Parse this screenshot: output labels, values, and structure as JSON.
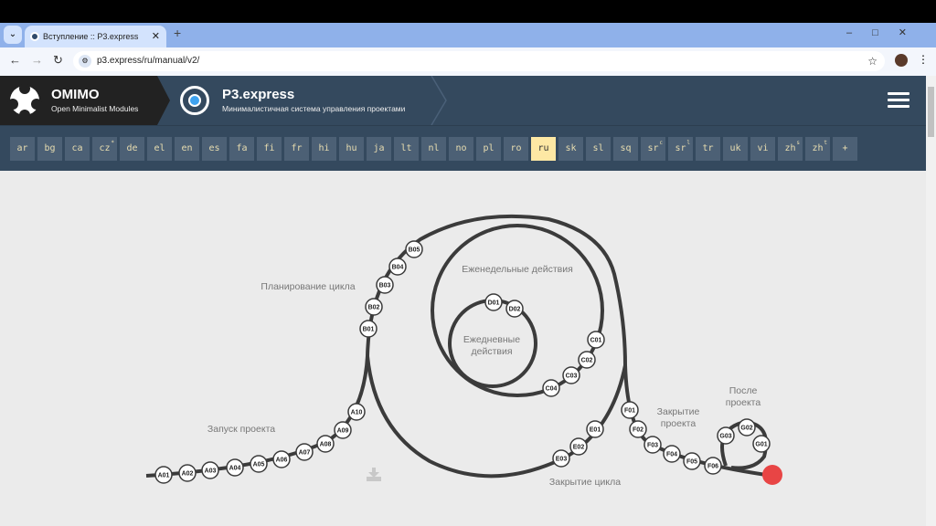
{
  "browser": {
    "tab_title": "Вступление :: P3.express",
    "url": "p3.express/ru/manual/v2/"
  },
  "header": {
    "omimo_title": "OMIMO",
    "omimo_subtitle": "Open Minimalist Modules",
    "p3_title": "P3.express",
    "p3_subtitle": "Минималистичная система управления проектами"
  },
  "languages": [
    {
      "code": "ar"
    },
    {
      "code": "bg"
    },
    {
      "code": "ca"
    },
    {
      "code": "cz",
      "sup": "*"
    },
    {
      "code": "de"
    },
    {
      "code": "el"
    },
    {
      "code": "en"
    },
    {
      "code": "es"
    },
    {
      "code": "fa"
    },
    {
      "code": "fi"
    },
    {
      "code": "fr"
    },
    {
      "code": "hi"
    },
    {
      "code": "hu"
    },
    {
      "code": "ja"
    },
    {
      "code": "lt"
    },
    {
      "code": "nl"
    },
    {
      "code": "no"
    },
    {
      "code": "pl"
    },
    {
      "code": "ro"
    },
    {
      "code": "ru",
      "active": true
    },
    {
      "code": "sk"
    },
    {
      "code": "sl"
    },
    {
      "code": "sq"
    },
    {
      "code": "sr",
      "sup": "c"
    },
    {
      "code": "sr",
      "sup": "l"
    },
    {
      "code": "tr"
    },
    {
      "code": "uk"
    },
    {
      "code": "vi"
    },
    {
      "code": "zh",
      "sup": "s"
    },
    {
      "code": "zh",
      "sup": "t"
    },
    {
      "code": "+"
    }
  ],
  "diagram": {
    "labels": {
      "planning": "Планирование цикла",
      "weekly": "Еженедельные действия",
      "daily1": "Ежедневные",
      "daily2": "действия",
      "launch": "Запуск проекта",
      "closure1": "Закрытие",
      "closure2": "проекта",
      "after1": "После",
      "after2": "проекта",
      "cycle_close": "Закрытие цикла"
    },
    "nodes": [
      "A01",
      "A02",
      "A03",
      "A04",
      "A05",
      "A06",
      "A07",
      "A08",
      "A09",
      "A10",
      "B01",
      "B02",
      "B03",
      "B04",
      "B05",
      "D01",
      "D02",
      "C01",
      "C02",
      "C03",
      "C04",
      "E01",
      "E02",
      "E03",
      "F01",
      "F02",
      "F03",
      "F04",
      "F05",
      "F06",
      "G01",
      "G02",
      "G03"
    ],
    "end_color": "#e84545"
  }
}
